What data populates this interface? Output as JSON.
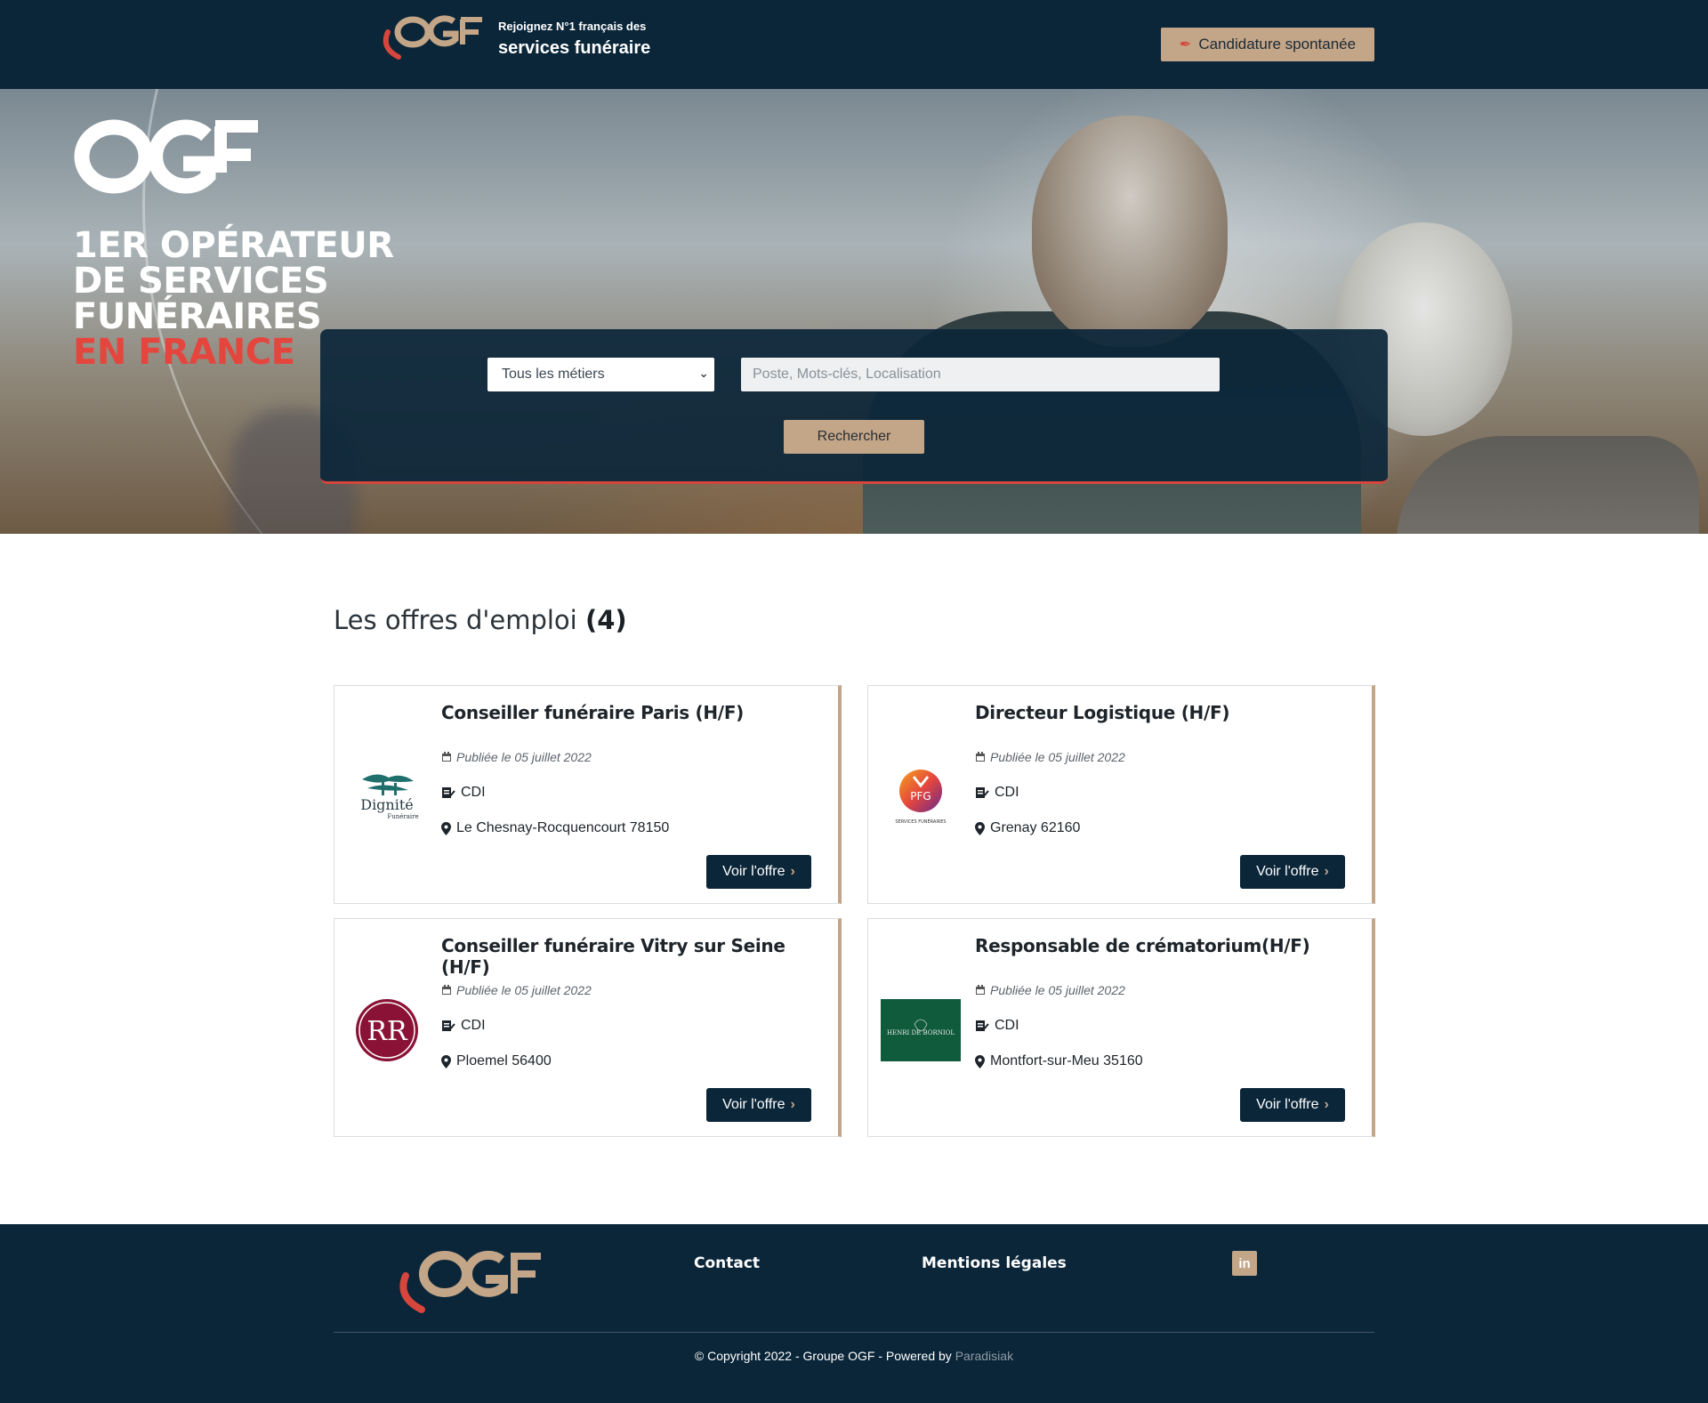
{
  "header": {
    "tagline_small": "Rejoignez N°1 français des",
    "tagline_big": "services funéraire",
    "cta_label": "Candidature spontanée"
  },
  "hero": {
    "title_lines": [
      "1ER OPÉRATEUR",
      "DE SERVICES",
      "FUNÉRAIRES"
    ],
    "title_accent": "EN FRANCE"
  },
  "search": {
    "category_selected": "Tous les métiers",
    "keywords_placeholder": "Poste, Mots-clés, Localisation",
    "button_label": "Rechercher"
  },
  "jobs": {
    "heading": "Les offres d'emploi",
    "count": "(4)",
    "list": [
      {
        "title": "Conseiller funéraire Paris (H/F)",
        "date": "Publiée le 05 juillet 2022",
        "contract": "CDI",
        "location": "Le Chesnay-Rocquencourt 78150",
        "button": "Voir l'offre",
        "logo_main": "Dignité",
        "logo_sub": "Funéraire"
      },
      {
        "title": "Directeur Logistique (H/F)",
        "date": "Publiée le 05 juillet 2022",
        "contract": "CDI",
        "location": "Grenay 62160",
        "button": "Voir l'offre",
        "logo_main": "PFG",
        "logo_sub": "SERVICES FUNÉRAIRES"
      },
      {
        "title": "Conseiller funéraire Vitry sur Seine (H/F)",
        "date": "Publiée le 05 juillet 2022",
        "contract": "CDI",
        "location": "Ploemel 56400",
        "button": "Voir l'offre",
        "logo_main": "RR",
        "logo_sub": ""
      },
      {
        "title": "Responsable de crématorium(H/F)",
        "date": "Publiée le 05 juillet 2022",
        "contract": "CDI",
        "location": "Montfort-sur-Meu 35160",
        "button": "Voir l'offre",
        "logo_main": "HENRI DE BORNIOL",
        "logo_sub": ""
      }
    ]
  },
  "footer": {
    "contact": "Contact",
    "legal": "Mentions légales",
    "social": "in",
    "copyright": "© Copyright 2022 - Groupe OGF - Powered by",
    "powered_by": "Paradisiak"
  },
  "colors": {
    "navy": "#0b2639",
    "sand": "#c3a588",
    "red": "#e4463e"
  }
}
